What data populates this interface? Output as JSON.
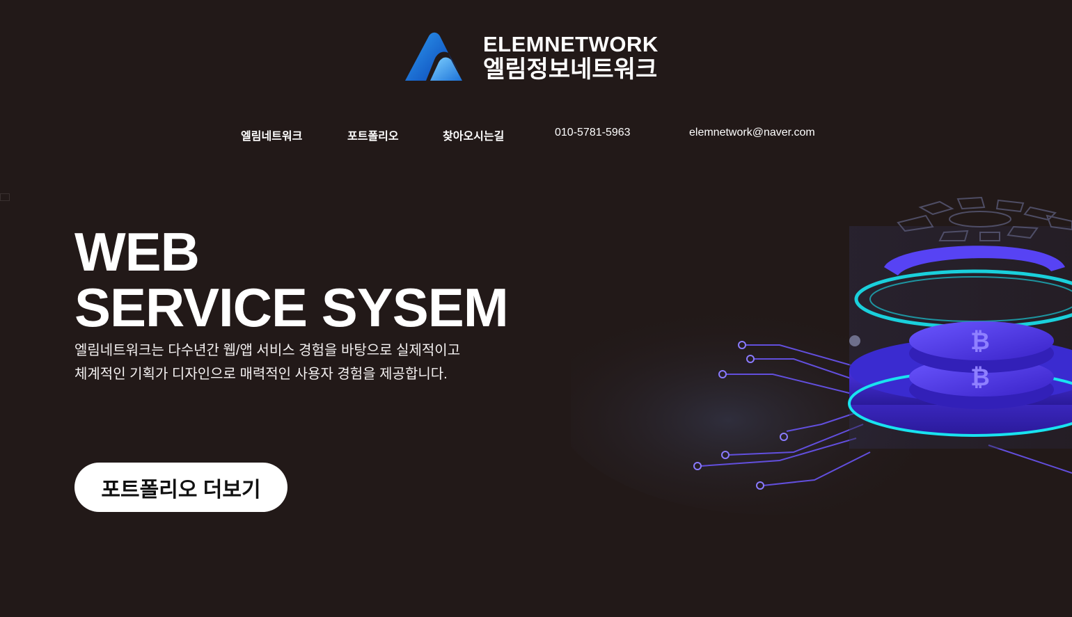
{
  "header": {
    "logo_en": "ELEMNETWORK",
    "logo_ko": "엘림정보네트워크"
  },
  "nav": {
    "items": [
      {
        "label": "엘림네트워크"
      },
      {
        "label": "포트폴리오"
      },
      {
        "label": "찾아오시는길"
      },
      {
        "label": "010-5781-5963"
      },
      {
        "label": "elemnetwork@naver.com"
      }
    ]
  },
  "hero": {
    "title_line1": "WEB",
    "title_line2": "SERVICE SYSEM",
    "desc_line1": "엘림네트워크는 다수년간 웹/앱 서비스 경험을 바탕으로 실제적이고",
    "desc_line2": "체계적인 기획가 디자인으로 매력적인 사용자 경험을 제공합니다.",
    "cta_label": "포트폴리오 더보기"
  },
  "colors": {
    "background": "#221918",
    "logo_blue": "#1e6fd9",
    "neon_cyan": "#19e3f0",
    "neon_purple": "#5a3df0"
  },
  "illustration": {
    "icon": "bitcoin-coin-stack-icon"
  }
}
